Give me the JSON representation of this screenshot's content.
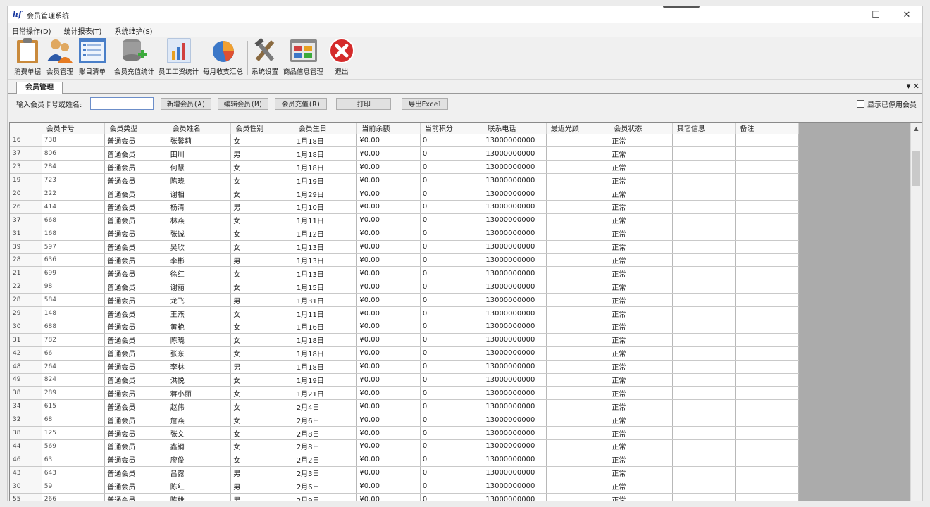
{
  "window": {
    "title": "会员管理系统",
    "logo": "hf"
  },
  "menu": [
    "日常操作(D)",
    "统计报表(T)",
    "系统维护(S)"
  ],
  "toolbar": [
    {
      "label": "消费单据",
      "icon": "clipboard-icon"
    },
    {
      "label": "会员管理",
      "icon": "members-icon"
    },
    {
      "label": "账目清单",
      "icon": "list-icon"
    },
    {
      "label": "会员充值统计",
      "icon": "database-add-icon"
    },
    {
      "label": "员工工资统计",
      "icon": "bar-chart-icon"
    },
    {
      "label": "每月收支汇总",
      "icon": "pie-chart-icon"
    },
    {
      "label": "系统设置",
      "icon": "tools-icon"
    },
    {
      "label": "商品信息管理",
      "icon": "grid-window-icon"
    },
    {
      "label": "退出",
      "icon": "exit-icon"
    }
  ],
  "tab": {
    "label": "会员管理",
    "ctrls": "▾ ✕"
  },
  "search": {
    "label": "输入会员卡号或姓名:",
    "value": "",
    "buttons": [
      "新增会员(A)",
      "编辑会员(M)",
      "会员充值(R)",
      "打印",
      "导出Excel"
    ],
    "show_disabled": "显示已停用会员"
  },
  "grid": {
    "columns": [
      "会员卡号",
      "会员类型",
      "会员姓名",
      "会员性别",
      "会员生日",
      "当前余额",
      "当前积分",
      "联系电话",
      "最近光顾",
      "会员状态",
      "其它信息",
      "备注"
    ],
    "rows": [
      [
        "16",
        "738",
        "普通会员",
        "张馨莉",
        "女",
        "1月18日",
        "¥0.00",
        "0",
        "13000000000",
        "",
        "正常",
        "",
        ""
      ],
      [
        "37",
        "806",
        "普通会员",
        "田川",
        "男",
        "1月18日",
        "¥0.00",
        "0",
        "13000000000",
        "",
        "正常",
        "",
        ""
      ],
      [
        "23",
        "284",
        "普通会员",
        "何慧",
        "女",
        "1月18日",
        "¥0.00",
        "0",
        "13000000000",
        "",
        "正常",
        "",
        ""
      ],
      [
        "19",
        "723",
        "普通会员",
        "陈晓",
        "女",
        "1月19日",
        "¥0.00",
        "0",
        "13000000000",
        "",
        "正常",
        "",
        ""
      ],
      [
        "20",
        "222",
        "普通会员",
        "谢相",
        "女",
        "1月29日",
        "¥0.00",
        "0",
        "13000000000",
        "",
        "正常",
        "",
        ""
      ],
      [
        "26",
        "414",
        "普通会员",
        "杨清",
        "男",
        "1月10日",
        "¥0.00",
        "0",
        "13000000000",
        "",
        "正常",
        "",
        ""
      ],
      [
        "37",
        "668",
        "普通会员",
        "林燕",
        "女",
        "1月11日",
        "¥0.00",
        "0",
        "13000000000",
        "",
        "正常",
        "",
        ""
      ],
      [
        "31",
        "168",
        "普通会员",
        "张诚",
        "女",
        "1月12日",
        "¥0.00",
        "0",
        "13000000000",
        "",
        "正常",
        "",
        ""
      ],
      [
        "39",
        "597",
        "普通会员",
        "吴欣",
        "女",
        "1月13日",
        "¥0.00",
        "0",
        "13000000000",
        "",
        "正常",
        "",
        ""
      ],
      [
        "28",
        "636",
        "普通会员",
        "李彬",
        "男",
        "1月13日",
        "¥0.00",
        "0",
        "13000000000",
        "",
        "正常",
        "",
        ""
      ],
      [
        "21",
        "699",
        "普通会员",
        "徐红",
        "女",
        "1月13日",
        "¥0.00",
        "0",
        "13000000000",
        "",
        "正常",
        "",
        ""
      ],
      [
        "22",
        "98",
        "普通会员",
        "谢丽",
        "女",
        "1月15日",
        "¥0.00",
        "0",
        "13000000000",
        "",
        "正常",
        "",
        ""
      ],
      [
        "28",
        "584",
        "普通会员",
        "龙飞",
        "男",
        "1月31日",
        "¥0.00",
        "0",
        "13000000000",
        "",
        "正常",
        "",
        ""
      ],
      [
        "29",
        "148",
        "普通会员",
        "王燕",
        "女",
        "1月11日",
        "¥0.00",
        "0",
        "13000000000",
        "",
        "正常",
        "",
        ""
      ],
      [
        "30",
        "688",
        "普通会员",
        "黄艳",
        "女",
        "1月16日",
        "¥0.00",
        "0",
        "13000000000",
        "",
        "正常",
        "",
        ""
      ],
      [
        "31",
        "782",
        "普通会员",
        "陈晓",
        "女",
        "1月18日",
        "¥0.00",
        "0",
        "13000000000",
        "",
        "正常",
        "",
        ""
      ],
      [
        "42",
        "66",
        "普通会员",
        "张东",
        "女",
        "1月18日",
        "¥0.00",
        "0",
        "13000000000",
        "",
        "正常",
        "",
        ""
      ],
      [
        "48",
        "264",
        "普通会员",
        "李林",
        "男",
        "1月18日",
        "¥0.00",
        "0",
        "13000000000",
        "",
        "正常",
        "",
        ""
      ],
      [
        "49",
        "824",
        "普通会员",
        "洪悦",
        "女",
        "1月19日",
        "¥0.00",
        "0",
        "13000000000",
        "",
        "正常",
        "",
        ""
      ],
      [
        "38",
        "289",
        "普通会员",
        "蒋小丽",
        "女",
        "1月21日",
        "¥0.00",
        "0",
        "13000000000",
        "",
        "正常",
        "",
        ""
      ],
      [
        "34",
        "615",
        "普通会员",
        "赵伟",
        "女",
        "2月4日",
        "¥0.00",
        "0",
        "13000000000",
        "",
        "正常",
        "",
        ""
      ],
      [
        "32",
        "68",
        "普通会员",
        "詹燕",
        "女",
        "2月6日",
        "¥0.00",
        "0",
        "13000000000",
        "",
        "正常",
        "",
        ""
      ],
      [
        "38",
        "125",
        "普通会员",
        "张文",
        "女",
        "2月8日",
        "¥0.00",
        "0",
        "13000000000",
        "",
        "正常",
        "",
        ""
      ],
      [
        "44",
        "569",
        "普通会员",
        "鑫钢",
        "女",
        "2月8日",
        "¥0.00",
        "0",
        "13000000000",
        "",
        "正常",
        "",
        ""
      ],
      [
        "46",
        "63",
        "普通会员",
        "廖俊",
        "女",
        "2月2日",
        "¥0.00",
        "0",
        "13000000000",
        "",
        "正常",
        "",
        ""
      ],
      [
        "43",
        "643",
        "普通会员",
        "吕露",
        "男",
        "2月3日",
        "¥0.00",
        "0",
        "13000000000",
        "",
        "正常",
        "",
        ""
      ],
      [
        "30",
        "59",
        "普通会员",
        "陈红",
        "男",
        "2月6日",
        "¥0.00",
        "0",
        "13000000000",
        "",
        "正常",
        "",
        ""
      ],
      [
        "55",
        "266",
        "普通会员",
        "陈雄",
        "男",
        "2月9日",
        "¥0.00",
        "0",
        "13000000000",
        "",
        "正常",
        "",
        ""
      ]
    ]
  }
}
